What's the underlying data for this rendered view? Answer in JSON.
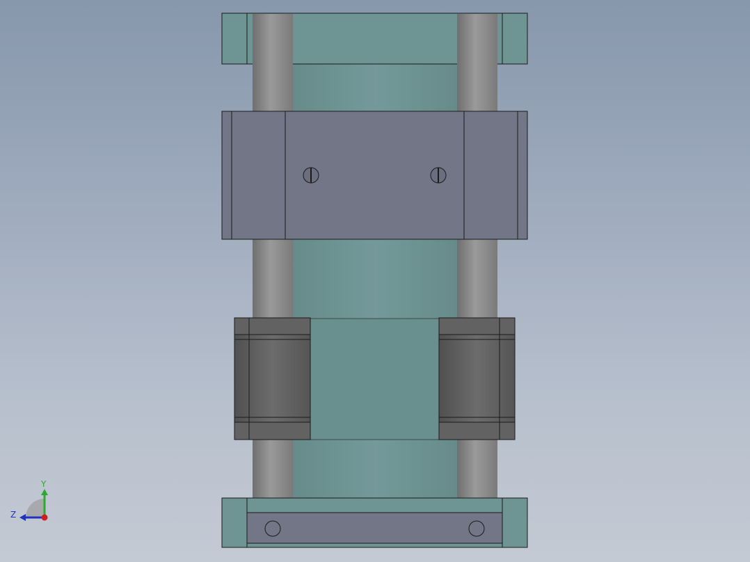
{
  "viewport": {
    "background": [
      "#8797ac",
      "#c4cad4"
    ]
  },
  "model": {
    "parts": [
      "top-end-block",
      "guide-rod-left",
      "guide-rod-right",
      "central-plate",
      "clamp-block",
      "clamp-screw-left",
      "clamp-screw-right",
      "linear-bearing-left",
      "linear-bearing-right",
      "bottom-base-block",
      "base-hole-left",
      "base-hole-right"
    ],
    "colors": {
      "plate_teal": "#6e9493",
      "rod_gray": "#8c8c8c",
      "clamp_slate": "#727687",
      "bearing_dark": "#676767",
      "edge": "#1a1a1a"
    }
  },
  "triad": {
    "y_label": "Y",
    "z_label": "Z",
    "y_color": "#2ea82e",
    "z_color": "#2233bb",
    "x_color": "#cc2020",
    "icon": "axis-triad-icon"
  }
}
